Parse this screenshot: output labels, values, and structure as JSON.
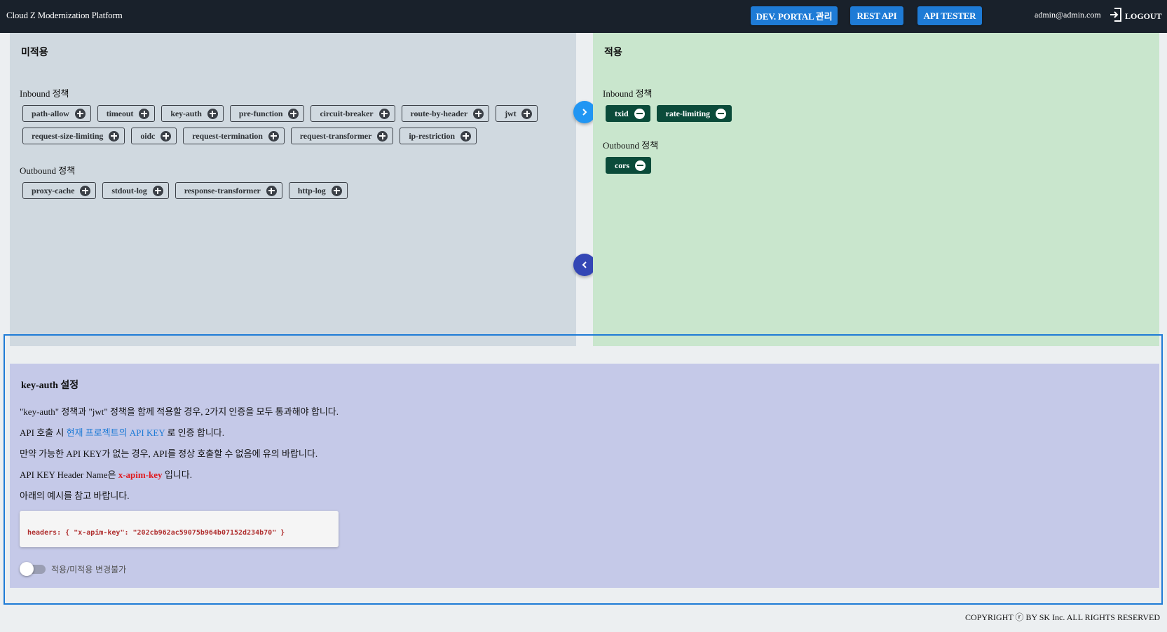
{
  "header": {
    "brand": "Cloud Z Modernization Platform",
    "buttons": [
      "DEV. PORTAL 관리",
      "REST API",
      "API TESTER"
    ],
    "user": "admin@admin.com",
    "logout": "LOGOUT",
    "accent": "#1e7bd6",
    "bg": "#19212b"
  },
  "unapplied": {
    "title": "미적용",
    "inbound_label": "Inbound 정책",
    "inbound": [
      "path-allow",
      "timeout",
      "key-auth",
      "pre-function",
      "circuit-breaker",
      "route-by-header",
      "jwt",
      "request-size-limiting",
      "oidc",
      "request-termination",
      "request-transformer",
      "ip-restriction"
    ],
    "outbound_label": "Outbound 정책",
    "outbound": [
      "proxy-cache",
      "stdout-log",
      "response-transformer",
      "http-log"
    ]
  },
  "applied": {
    "title": "적용",
    "inbound_label": "Inbound 정책",
    "inbound": [
      "txid",
      "rate-limiting"
    ],
    "outbound_label": "Outbound 정책",
    "outbound": [
      "cors"
    ]
  },
  "settings": {
    "title": "key-auth 설정",
    "line1": "\"key-auth\" 정책과 \"jwt\" 정책을 함께 적용할 경우, 2가지 인증을 모두 통과해야 합니다.",
    "line2_prefix": "API 호출 시 ",
    "line2_link": "현재 프로젝트의 API KEY",
    "line2_suffix": " 로 인증 합니다.",
    "line3": "만약 가능한 API KEY가 없는 경우, API를 정상 호출할 수 없음에 유의 바랍니다.",
    "line4_prefix": "API KEY Header Name은 ",
    "line4_key": "x-apim-key",
    "line4_suffix": " 입니다.",
    "line5": "아래의 예시를 참고 바랍니다.",
    "code": "headers: { \"x-apim-key\": \"202cb962ac59075b964b07152d234b70\" }",
    "toggle_label": "적용/미적용 변경불가",
    "toggle_on": false
  },
  "footer": "COPYRIGHT ⓡ BY SK Inc. ALL RIGHTS RESERVED"
}
